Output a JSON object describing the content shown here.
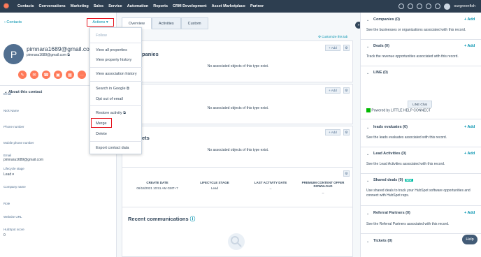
{
  "nav": {
    "items": [
      "Contacts",
      "Conversations",
      "Marketing",
      "Sales",
      "Service",
      "Automation",
      "Reports",
      "CRM Development",
      "Asset Marketplace",
      "Partner"
    ],
    "account": "ourgreenfish"
  },
  "left": {
    "breadcrumb": "Contacts",
    "actions_label": "Actions",
    "avatar_initial": "P",
    "name": "pimnara1689@gmail.com",
    "email": "pimnara1689@gmail.com",
    "about_title": "About this contact",
    "props": [
      {
        "label": "Email",
        "value": ""
      },
      {
        "label": "Nick Name",
        "value": ""
      },
      {
        "label": "Phone number",
        "value": ""
      },
      {
        "label": "Mobile phone number",
        "value": ""
      },
      {
        "label": "Email",
        "value": "pimnara1689@gmail.com"
      },
      {
        "label": "Lifecycle stage",
        "value": "Lead"
      },
      {
        "label": "Company name",
        "value": ""
      },
      {
        "label": "Role",
        "value": ""
      },
      {
        "label": "Website URL",
        "value": ""
      },
      {
        "label": "HubSpot score",
        "value": "0"
      }
    ],
    "menu": [
      "Follow",
      "View all properties",
      "View property history",
      "View association history",
      "Search in Google",
      "Opt out of email",
      "Restore activity",
      "Merge",
      "Delete",
      "Export contact data"
    ]
  },
  "middle": {
    "tabs": [
      "Overview",
      "Activities",
      "Custom"
    ],
    "customize": "Customize this tab",
    "card1_title": "panies",
    "card3_title": "ets",
    "no_assoc": "No associated objects of this type exist.",
    "add_label": "+ Add",
    "summary": {
      "headers": [
        "CREATE DATE",
        "LIFECYCLE STAGE",
        "LAST ACTIVITY DATE",
        "PREMIUM CONTENT OFFER DOWNLOAD"
      ],
      "values": [
        "06/18/2021 10:51 AM GMT+7",
        "Lead",
        "--",
        "--"
      ]
    },
    "recent_title": "Recent communications"
  },
  "right": {
    "sections": [
      {
        "title": "Companies (0)",
        "content": "See the businesses or organizations associated with this record."
      },
      {
        "title": "Deals (0)",
        "content": "Track the revenue opportunities associated with this record."
      },
      {
        "title": "LINE (0)",
        "content": ""
      },
      {
        "title": "leads evaluates (0)",
        "content": "See the leads evaluates associated with this record."
      },
      {
        "title": "Lead Activities (0)",
        "content": "See the Lead Activities associated with this record."
      },
      {
        "title": "Shared deals (0)",
        "content": "Use shared deals to track your HubSpot software opportunities and connect with HubSpot reps."
      },
      {
        "title": "Referral Partners (0)",
        "content": "See the Referral Partners associated with this record."
      },
      {
        "title": "Tickets (0)",
        "content": ""
      }
    ],
    "add_label": "+ Add",
    "line_button": "LINE Chat",
    "powered": "Powered by LITTLE HELP CONNECT",
    "new_badge": "NEW"
  },
  "help": "Help"
}
